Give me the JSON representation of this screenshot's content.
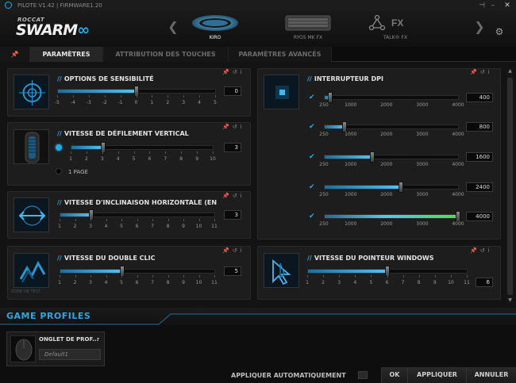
{
  "titlebar": {
    "version": "PILOTE V1.42 | FIRMWARE1.20",
    "pin": "⊣",
    "minimize": "–",
    "close": "✕"
  },
  "logo": {
    "brand": "ROCCAT",
    "product_main": "SWARM",
    "product_dots": "∞"
  },
  "devices": [
    {
      "label": "KIRO",
      "icon": "mouse-icon",
      "active": true
    },
    {
      "label": "RYOS MK FX",
      "icon": "keyboard-icon",
      "active": false
    },
    {
      "label": "TALK® FX",
      "icon": "talk-fx-icon",
      "active": false
    }
  ],
  "nav": {
    "prev": "❮",
    "next": "❯",
    "settings_icon": "gear-icon"
  },
  "tabs": [
    {
      "label": "PARAMÈTRES",
      "active": true
    },
    {
      "label": "ATTRIBUTION DES TOUCHES",
      "active": false
    },
    {
      "label": "PARAMÈTRES AVANCÉS",
      "active": false
    }
  ],
  "tab_pin": "📌",
  "panel_icons": {
    "pin": "📌",
    "reset": "↺",
    "info": "i"
  },
  "sensitivity": {
    "title": "OPTIONS DE SENSIBILITÉ",
    "value": "0",
    "ticks": [
      "-5",
      "-4",
      "-3",
      "-2",
      "-1",
      "0",
      "1",
      "2",
      "3",
      "4",
      "5"
    ],
    "level": 0.5
  },
  "vscroll": {
    "title": "VITESSE DE DÉFILEMENT VERTICAL",
    "value": "3",
    "ticks": [
      "1",
      "2",
      "3",
      "4",
      "5",
      "6",
      "7",
      "8",
      "9",
      "10"
    ],
    "level": 0.222,
    "page_label": "1 PAGE"
  },
  "htilt": {
    "title": "VITESSE D'INCLINAISON HORIZONTALE (EN",
    "value": "3",
    "ticks": [
      "1",
      "2",
      "3",
      "4",
      "5",
      "6",
      "7",
      "8",
      "9",
      "10",
      "11"
    ],
    "level": 0.2
  },
  "dblclick": {
    "title": "VITESSE DU DOUBLE CLIC",
    "value": "5",
    "ticks": [
      "1",
      "2",
      "3",
      "4",
      "5",
      "6",
      "7",
      "8",
      "9",
      "10",
      "11"
    ],
    "level": 0.4,
    "test_zone": "ZONE DE TEST"
  },
  "dpi": {
    "title": "INTERRUPTEUR DPI",
    "ticks": [
      "250",
      "1000",
      "2000",
      "3000",
      "4000"
    ],
    "rows": [
      {
        "checked": true,
        "value": "400",
        "level": 0.04
      },
      {
        "checked": true,
        "value": "800",
        "level": 0.147
      },
      {
        "checked": true,
        "value": "1600",
        "level": 0.36
      },
      {
        "checked": true,
        "value": "2400",
        "level": 0.573
      },
      {
        "checked": true,
        "value": "4000",
        "level": 1.0
      }
    ]
  },
  "pointer": {
    "title": "VITESSE DU POINTEUR WINDOWS",
    "value": "6",
    "ticks": [
      "1",
      "2",
      "3",
      "4",
      "5",
      "6",
      "7",
      "8",
      "9",
      "10",
      "11"
    ],
    "level": 0.5
  },
  "game_profiles": {
    "title": "GAME PROFILES",
    "profile_tab": "ONGLET DE PROF...",
    "profile_name": "Default1"
  },
  "footer": {
    "auto_apply": "APPLIQUER AUTOMATIQUEMENT",
    "ok": "OK",
    "apply": "APPLIQUER",
    "cancel": "ANNULER"
  },
  "colors": {
    "accent": "#29a8e8",
    "green_end": "#4ee04a"
  }
}
